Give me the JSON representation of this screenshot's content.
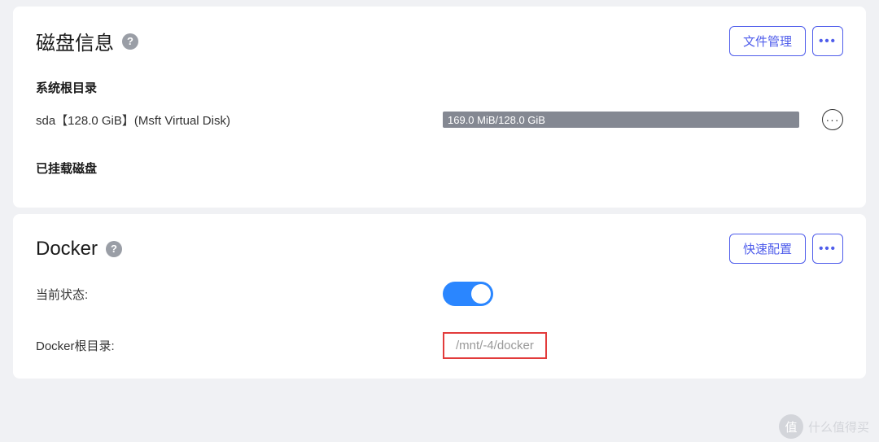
{
  "disk": {
    "title": "磁盘信息",
    "manage_label": "文件管理",
    "root_section_label": "系统根目录",
    "row": {
      "name": "sda【128.0 GiB】(Msft Virtual Disk)",
      "usage": "169.0 MiB/128.0 GiB"
    },
    "mounted_section_label": "已挂载磁盘"
  },
  "docker": {
    "title": "Docker",
    "quick_config_label": "快速配置",
    "status_label": "当前状态:",
    "root_label": "Docker根目录:",
    "root_path": "/mnt/-4/docker"
  },
  "watermark": {
    "badge": "值",
    "text": "什么值得买"
  }
}
